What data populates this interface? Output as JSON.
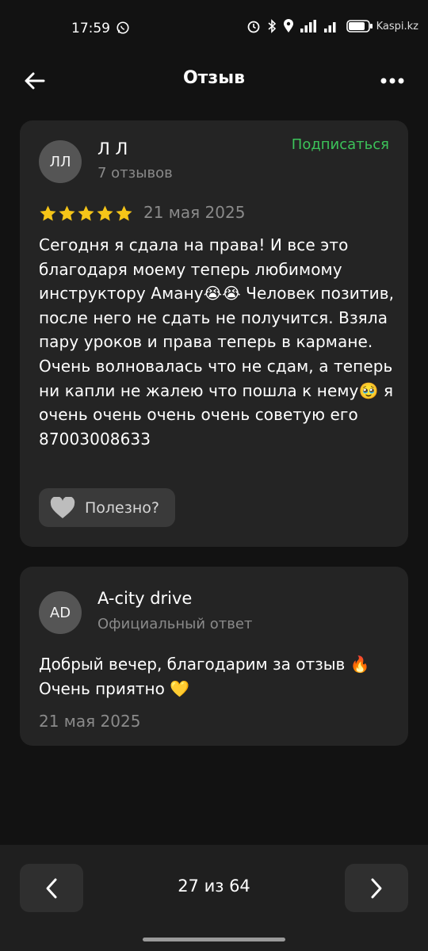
{
  "status_bar": {
    "time": "17:59",
    "watermark": "Kaspi.kz",
    "icons": [
      "whatsapp-icon",
      "alarm-icon",
      "bluetooth-icon",
      "location-icon",
      "signal-icon",
      "signal-icon-2",
      "battery-icon"
    ]
  },
  "header": {
    "title": "Отзыв",
    "back_icon": "arrow-left-icon",
    "more_icon": "more-dots-icon"
  },
  "review": {
    "avatar_initials": "ЛЛ",
    "author": "Л Л",
    "reviews_count": "7 отзывов",
    "subscribe_label": "Подписаться",
    "rating": 5,
    "rating_max": 5,
    "date": "21 мая 2025",
    "text": "Сегодня я сдала на права! И все это благодаря моему теперь любимому инструктору Аману😭😭 Человек позитив, после него не сдать не получится. Взяла пару уроков и права теперь в кармане. Очень волновалась что не сдам, а теперь ни капли не жалею что пошла к нему🥹 я очень очень очень очень советую его 87003008633",
    "helpful_label": "Полезно?"
  },
  "reply": {
    "avatar_initials": "AD",
    "author": "A-city drive",
    "subtitle": "Официальный ответ",
    "text": "Добрый вечер, благодарим за отзыв 🔥 Очень приятно 💛",
    "date": "21 мая 2025"
  },
  "pagination": {
    "label": "27 из 64",
    "prev_icon": "chevron-left-icon",
    "next_icon": "chevron-right-icon"
  },
  "colors": {
    "background": "#121212",
    "card": "#242424",
    "accent_green": "#3cc35a",
    "star": "#f5c518",
    "muted_text": "#8a8a8a"
  }
}
